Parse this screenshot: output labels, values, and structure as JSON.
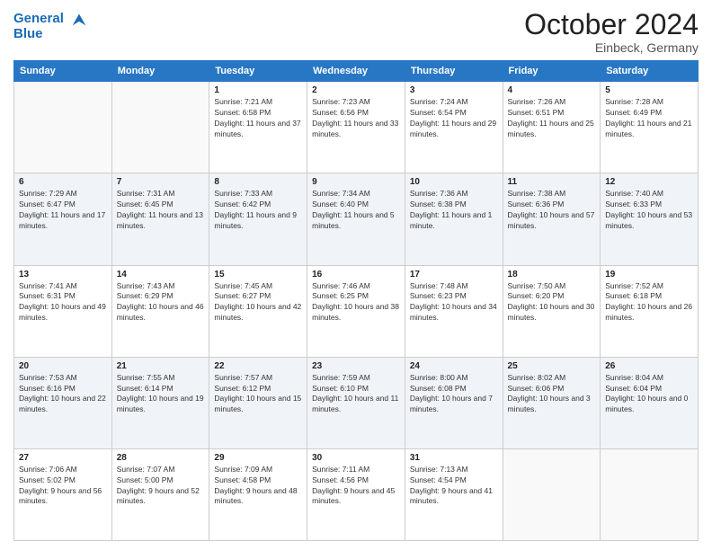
{
  "header": {
    "logo_line1": "General",
    "logo_line2": "Blue",
    "month": "October 2024",
    "location": "Einbeck, Germany"
  },
  "weekdays": [
    "Sunday",
    "Monday",
    "Tuesday",
    "Wednesday",
    "Thursday",
    "Friday",
    "Saturday"
  ],
  "weeks": [
    [
      {
        "day": "",
        "sunrise": "",
        "sunset": "",
        "daylight": ""
      },
      {
        "day": "",
        "sunrise": "",
        "sunset": "",
        "daylight": ""
      },
      {
        "day": "1",
        "sunrise": "Sunrise: 7:21 AM",
        "sunset": "Sunset: 6:58 PM",
        "daylight": "Daylight: 11 hours and 37 minutes."
      },
      {
        "day": "2",
        "sunrise": "Sunrise: 7:23 AM",
        "sunset": "Sunset: 6:56 PM",
        "daylight": "Daylight: 11 hours and 33 minutes."
      },
      {
        "day": "3",
        "sunrise": "Sunrise: 7:24 AM",
        "sunset": "Sunset: 6:54 PM",
        "daylight": "Daylight: 11 hours and 29 minutes."
      },
      {
        "day": "4",
        "sunrise": "Sunrise: 7:26 AM",
        "sunset": "Sunset: 6:51 PM",
        "daylight": "Daylight: 11 hours and 25 minutes."
      },
      {
        "day": "5",
        "sunrise": "Sunrise: 7:28 AM",
        "sunset": "Sunset: 6:49 PM",
        "daylight": "Daylight: 11 hours and 21 minutes."
      }
    ],
    [
      {
        "day": "6",
        "sunrise": "Sunrise: 7:29 AM",
        "sunset": "Sunset: 6:47 PM",
        "daylight": "Daylight: 11 hours and 17 minutes."
      },
      {
        "day": "7",
        "sunrise": "Sunrise: 7:31 AM",
        "sunset": "Sunset: 6:45 PM",
        "daylight": "Daylight: 11 hours and 13 minutes."
      },
      {
        "day": "8",
        "sunrise": "Sunrise: 7:33 AM",
        "sunset": "Sunset: 6:42 PM",
        "daylight": "Daylight: 11 hours and 9 minutes."
      },
      {
        "day": "9",
        "sunrise": "Sunrise: 7:34 AM",
        "sunset": "Sunset: 6:40 PM",
        "daylight": "Daylight: 11 hours and 5 minutes."
      },
      {
        "day": "10",
        "sunrise": "Sunrise: 7:36 AM",
        "sunset": "Sunset: 6:38 PM",
        "daylight": "Daylight: 11 hours and 1 minute."
      },
      {
        "day": "11",
        "sunrise": "Sunrise: 7:38 AM",
        "sunset": "Sunset: 6:36 PM",
        "daylight": "Daylight: 10 hours and 57 minutes."
      },
      {
        "day": "12",
        "sunrise": "Sunrise: 7:40 AM",
        "sunset": "Sunset: 6:33 PM",
        "daylight": "Daylight: 10 hours and 53 minutes."
      }
    ],
    [
      {
        "day": "13",
        "sunrise": "Sunrise: 7:41 AM",
        "sunset": "Sunset: 6:31 PM",
        "daylight": "Daylight: 10 hours and 49 minutes."
      },
      {
        "day": "14",
        "sunrise": "Sunrise: 7:43 AM",
        "sunset": "Sunset: 6:29 PM",
        "daylight": "Daylight: 10 hours and 46 minutes."
      },
      {
        "day": "15",
        "sunrise": "Sunrise: 7:45 AM",
        "sunset": "Sunset: 6:27 PM",
        "daylight": "Daylight: 10 hours and 42 minutes."
      },
      {
        "day": "16",
        "sunrise": "Sunrise: 7:46 AM",
        "sunset": "Sunset: 6:25 PM",
        "daylight": "Daylight: 10 hours and 38 minutes."
      },
      {
        "day": "17",
        "sunrise": "Sunrise: 7:48 AM",
        "sunset": "Sunset: 6:23 PM",
        "daylight": "Daylight: 10 hours and 34 minutes."
      },
      {
        "day": "18",
        "sunrise": "Sunrise: 7:50 AM",
        "sunset": "Sunset: 6:20 PM",
        "daylight": "Daylight: 10 hours and 30 minutes."
      },
      {
        "day": "19",
        "sunrise": "Sunrise: 7:52 AM",
        "sunset": "Sunset: 6:18 PM",
        "daylight": "Daylight: 10 hours and 26 minutes."
      }
    ],
    [
      {
        "day": "20",
        "sunrise": "Sunrise: 7:53 AM",
        "sunset": "Sunset: 6:16 PM",
        "daylight": "Daylight: 10 hours and 22 minutes."
      },
      {
        "day": "21",
        "sunrise": "Sunrise: 7:55 AM",
        "sunset": "Sunset: 6:14 PM",
        "daylight": "Daylight: 10 hours and 19 minutes."
      },
      {
        "day": "22",
        "sunrise": "Sunrise: 7:57 AM",
        "sunset": "Sunset: 6:12 PM",
        "daylight": "Daylight: 10 hours and 15 minutes."
      },
      {
        "day": "23",
        "sunrise": "Sunrise: 7:59 AM",
        "sunset": "Sunset: 6:10 PM",
        "daylight": "Daylight: 10 hours and 11 minutes."
      },
      {
        "day": "24",
        "sunrise": "Sunrise: 8:00 AM",
        "sunset": "Sunset: 6:08 PM",
        "daylight": "Daylight: 10 hours and 7 minutes."
      },
      {
        "day": "25",
        "sunrise": "Sunrise: 8:02 AM",
        "sunset": "Sunset: 6:06 PM",
        "daylight": "Daylight: 10 hours and 3 minutes."
      },
      {
        "day": "26",
        "sunrise": "Sunrise: 8:04 AM",
        "sunset": "Sunset: 6:04 PM",
        "daylight": "Daylight: 10 hours and 0 minutes."
      }
    ],
    [
      {
        "day": "27",
        "sunrise": "Sunrise: 7:06 AM",
        "sunset": "Sunset: 5:02 PM",
        "daylight": "Daylight: 9 hours and 56 minutes."
      },
      {
        "day": "28",
        "sunrise": "Sunrise: 7:07 AM",
        "sunset": "Sunset: 5:00 PM",
        "daylight": "Daylight: 9 hours and 52 minutes."
      },
      {
        "day": "29",
        "sunrise": "Sunrise: 7:09 AM",
        "sunset": "Sunset: 4:58 PM",
        "daylight": "Daylight: 9 hours and 48 minutes."
      },
      {
        "day": "30",
        "sunrise": "Sunrise: 7:11 AM",
        "sunset": "Sunset: 4:56 PM",
        "daylight": "Daylight: 9 hours and 45 minutes."
      },
      {
        "day": "31",
        "sunrise": "Sunrise: 7:13 AM",
        "sunset": "Sunset: 4:54 PM",
        "daylight": "Daylight: 9 hours and 41 minutes."
      },
      {
        "day": "",
        "sunrise": "",
        "sunset": "",
        "daylight": ""
      },
      {
        "day": "",
        "sunrise": "",
        "sunset": "",
        "daylight": ""
      }
    ]
  ]
}
